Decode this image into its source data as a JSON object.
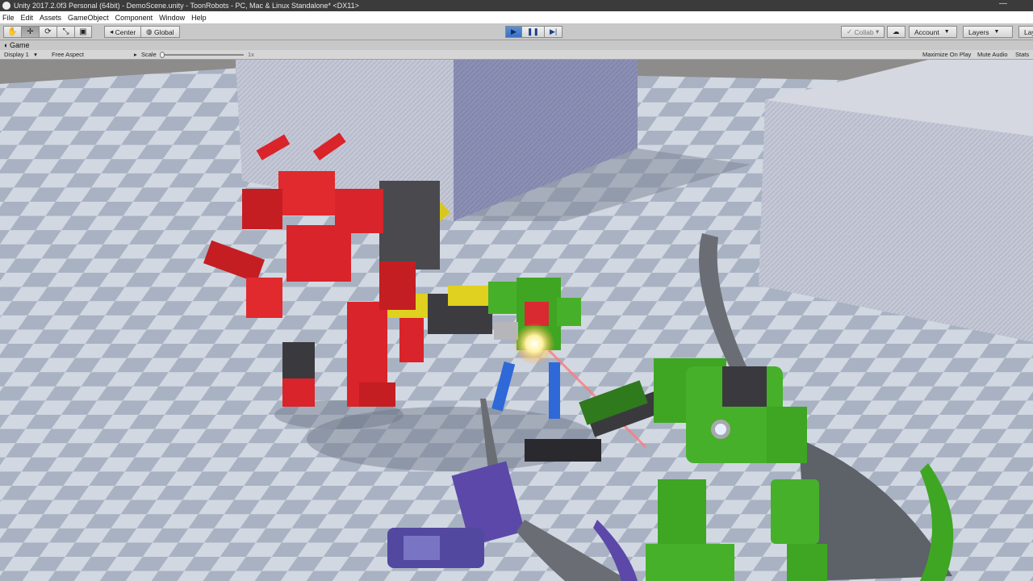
{
  "window": {
    "title": "Unity 2017.2.0f3 Personal (64bit) - DemoScene.unity - ToonRobots - PC, Mac & Linux Standalone* <DX11>",
    "minimize_glyph": "—"
  },
  "menu": {
    "items": [
      "File",
      "Edit",
      "Assets",
      "GameObject",
      "Component",
      "Window",
      "Help"
    ]
  },
  "toolbar": {
    "tools": [
      "hand-icon",
      "move-icon",
      "rotate-icon",
      "scale-icon",
      "rect-icon"
    ],
    "tool_glyphs": [
      "✋",
      "✛",
      "⟳",
      "⤡",
      "▣"
    ],
    "pivot": "Center",
    "space": "Global",
    "play_glyph": "▶",
    "pause_glyph": "❚❚",
    "step_glyph": "▶|",
    "collab": "Collab",
    "cloud_glyph": "☁",
    "account": "Account",
    "layers": "Layers",
    "layout": "Lay",
    "accent_color": "#3b6fc0"
  },
  "game_view": {
    "tab_label": "Game",
    "display": "Display 1",
    "aspect": "Free Aspect",
    "scale_label": "Scale",
    "scale_value": "1x",
    "scale_level": 0.0,
    "maximize_on_play": "Maximize On Play",
    "mute_audio": "Mute Audio",
    "stats": "Stats"
  },
  "scene": {
    "floor_colors": [
      "#a8b2c2",
      "#d2d8e2"
    ],
    "wall_color": "#8d8c8a",
    "cube_light": "#c4c8d6",
    "cube_shaded": "#8c8fb4",
    "robot_colors": {
      "red": "#d8242a",
      "green": "#3ea623",
      "blue": "#2f69d8",
      "yellow": "#e0d020",
      "purple": "#5c48a8"
    }
  }
}
